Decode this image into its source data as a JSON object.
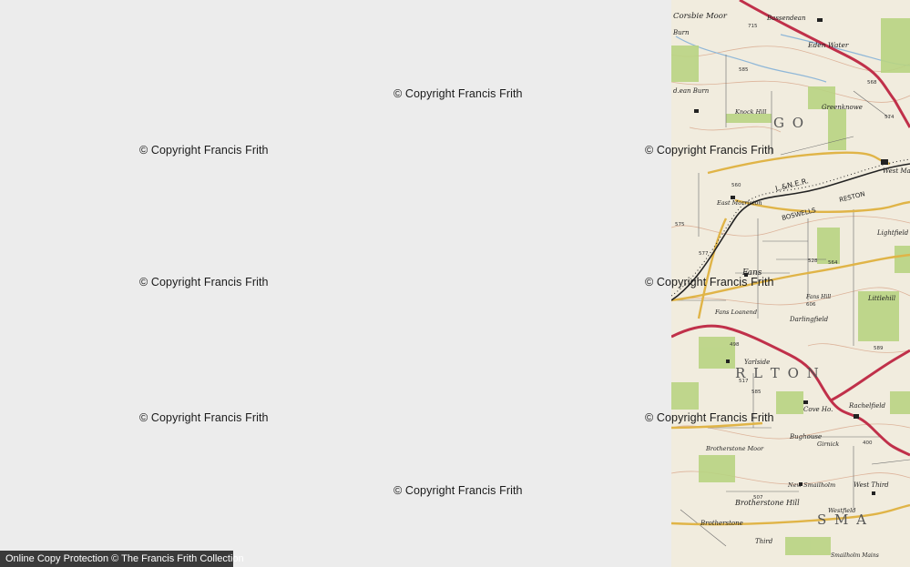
{
  "watermarks": [
    "© Copyright Francis Frith",
    "© Copyright Francis Frith",
    "© Copyright Francis Frith",
    "© Copyright Francis Frith",
    "© Copyright Francis Frith",
    "© Copyright Francis Frith",
    "© Copyright Francis Frith",
    "© Copyright Francis Frith",
    "© Copyright Francis Frith"
  ],
  "footer": {
    "label": "Online Copy Protection © The Francis Frith Collection"
  },
  "map": {
    "place_labels": {
      "corsbie_moor": "Corsbie Moor",
      "bassendean": "Bassendean",
      "burn": "Burn",
      "eden_water": "Eden Water",
      "dean_burn": "d.ean Burn",
      "knock_hill": "Knock Hill",
      "greenknowe": "Greenknowe",
      "west_mains": "West Mains",
      "east_morriston": "East Morriston",
      "lne_railway": "L.&N.E.R.",
      "boswells": "BOSWELLS",
      "reston": "RESTON",
      "fans": "Fans",
      "fans_hill": "Fans Hill",
      "darlingfield": "Darlingfield",
      "fans_loanend": "Fans Loanend",
      "yarlside": "Yarlside",
      "rachelfield": "Rachelfield",
      "cove_ho": "Cove Ho.",
      "bughouse": "Bughouse",
      "girnick": "Girnick",
      "brotherstone_moor": "Brotherstone Moor",
      "new_smailholm": "New Smailholm",
      "brotherstone_hill": "Brotherstone Hill",
      "west_third": "West Third",
      "westfield": "Westfield",
      "brotherstone": "Brotherstone",
      "third": "Third",
      "smailholm_mains": "Smailholm Mains",
      "lightfield": "Lightfield",
      "littlehill": "Littlehill",
      "gordon_letters": "G O",
      "earlston_letters": "R L T O N",
      "smailholm_letters": "S M A"
    },
    "heights": [
      "715",
      "585",
      "560",
      "575",
      "528",
      "564",
      "606",
      "577",
      "498",
      "517",
      "585",
      "589",
      "400",
      "507",
      "568",
      "574"
    ]
  },
  "colors": {
    "background": "#ececec",
    "map_paper": "#f1ecde",
    "main_road": "#c0304a",
    "secondary_road": "#e0b447",
    "woodland": "#b9d483",
    "contour": "#d8a58a",
    "water": "#8fb7d8"
  }
}
